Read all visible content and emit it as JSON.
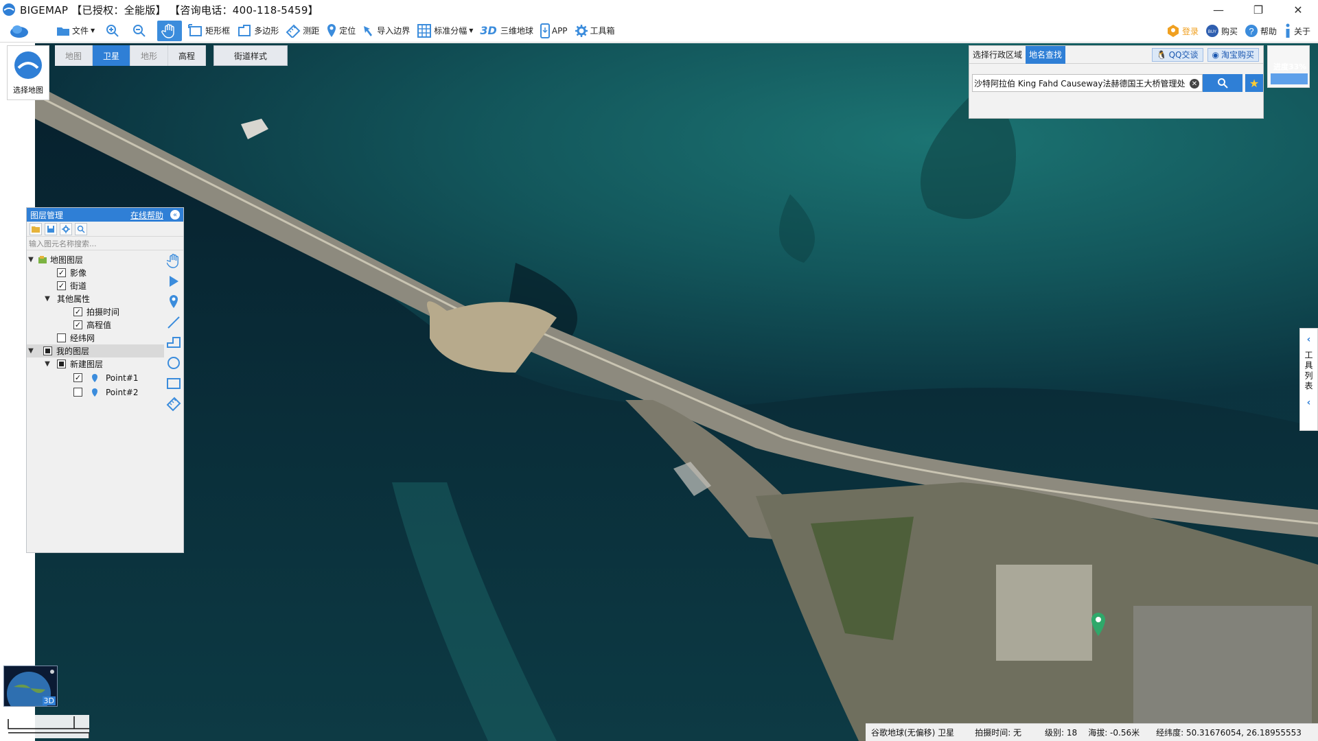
{
  "window": {
    "title": "BIGEMAP 【已授权：全能版】 【咨询电话：400-118-5459】",
    "controls": [
      "minimize",
      "maximize",
      "close"
    ]
  },
  "toolbar": {
    "items": [
      {
        "label": "文件",
        "icon": "folder-icon",
        "dropdown": true
      },
      {
        "label": "",
        "icon": "zoom-in-icon"
      },
      {
        "label": "",
        "icon": "zoom-out-icon"
      },
      {
        "label": "",
        "icon": "hand-pan-icon",
        "active": true
      },
      {
        "label": "矩形框",
        "icon": "rectangle-select-icon"
      },
      {
        "label": "多边形",
        "icon": "polygon-select-icon"
      },
      {
        "label": "测距",
        "icon": "ruler-icon"
      },
      {
        "label": "定位",
        "icon": "location-pin-icon"
      },
      {
        "label": "导入边界",
        "icon": "import-boundary-icon"
      },
      {
        "label": "标准分幅",
        "icon": "grid-icon",
        "dropdown": true
      },
      {
        "label": "三维地球",
        "icon": "3d-icon",
        "prefix": "3D"
      },
      {
        "label": "APP",
        "icon": "phone-icon"
      },
      {
        "label": "工具箱",
        "icon": "gear-icon"
      }
    ],
    "right": [
      {
        "label": "登录",
        "icon": "user-badge-icon"
      },
      {
        "label": "购买",
        "icon": "buy-icon"
      },
      {
        "label": "帮助",
        "icon": "help-icon"
      },
      {
        "label": "关于",
        "icon": "info-icon"
      }
    ]
  },
  "map_type": {
    "tabs": [
      "地图",
      "卫星",
      "地形",
      "高程"
    ],
    "active": "卫星",
    "street_style": "街道样式",
    "select_map_label": "选择地图"
  },
  "layer_panel": {
    "title": "图层管理",
    "help_link": "在线帮助",
    "search_placeholder": "输入图元名称搜索...",
    "tree": [
      {
        "label": "地图图层",
        "level": 0,
        "expanded": true,
        "checkbox": "none",
        "icon": "map-layer-icon"
      },
      {
        "label": "影像",
        "level": 1,
        "checkbox": "checked"
      },
      {
        "label": "街道",
        "level": 1,
        "checkbox": "checked"
      },
      {
        "label": "其他属性",
        "level": 1,
        "expanded": true,
        "checkbox": "none"
      },
      {
        "label": "拍摄时间",
        "level": 2,
        "checkbox": "checked"
      },
      {
        "label": "高程值",
        "level": 2,
        "checkbox": "checked"
      },
      {
        "label": "经纬网",
        "level": 1,
        "checkbox": "unchecked"
      },
      {
        "label": "我的图层",
        "level": 0,
        "expanded": true,
        "checkbox": "partial",
        "selected": true
      },
      {
        "label": "新建图层",
        "level": 1,
        "expanded": true,
        "checkbox": "partial"
      },
      {
        "label": "Point#1",
        "level": 2,
        "checkbox": "checked",
        "icon": "point-marker-icon"
      },
      {
        "label": "Point#2",
        "level": 2,
        "checkbox": "unchecked",
        "icon": "point-marker-icon"
      }
    ],
    "side_tools": [
      "hand-icon",
      "arrow-icon",
      "marker-icon",
      "line-icon",
      "polyline-icon",
      "circle-icon",
      "rectangle-icon",
      "ruler-icon"
    ]
  },
  "search_panel": {
    "tabs": [
      "选择行政区域",
      "地名查找"
    ],
    "active_tab": "地名查找",
    "qq_label": "QQ交谈",
    "taobao_label": "淘宝购买",
    "query": "沙特阿拉伯 King Fahd Causeway法赫德国王大桥管理处"
  },
  "progress": {
    "label": "进度33%",
    "percent": 33
  },
  "right_tools": {
    "label": "工具列表"
  },
  "globe": {
    "label": "3D"
  },
  "status": {
    "source": "谷歌地球(无偏移) 卫星",
    "capture_time": "拍摄时间: 无",
    "level": "级别:  18",
    "altitude": "海拔: -0.56米",
    "coords": "经纬度:  50.31676054, 26.18955553"
  },
  "colors": {
    "accent": "#2f7fd6",
    "water": "#0a2f3a"
  }
}
